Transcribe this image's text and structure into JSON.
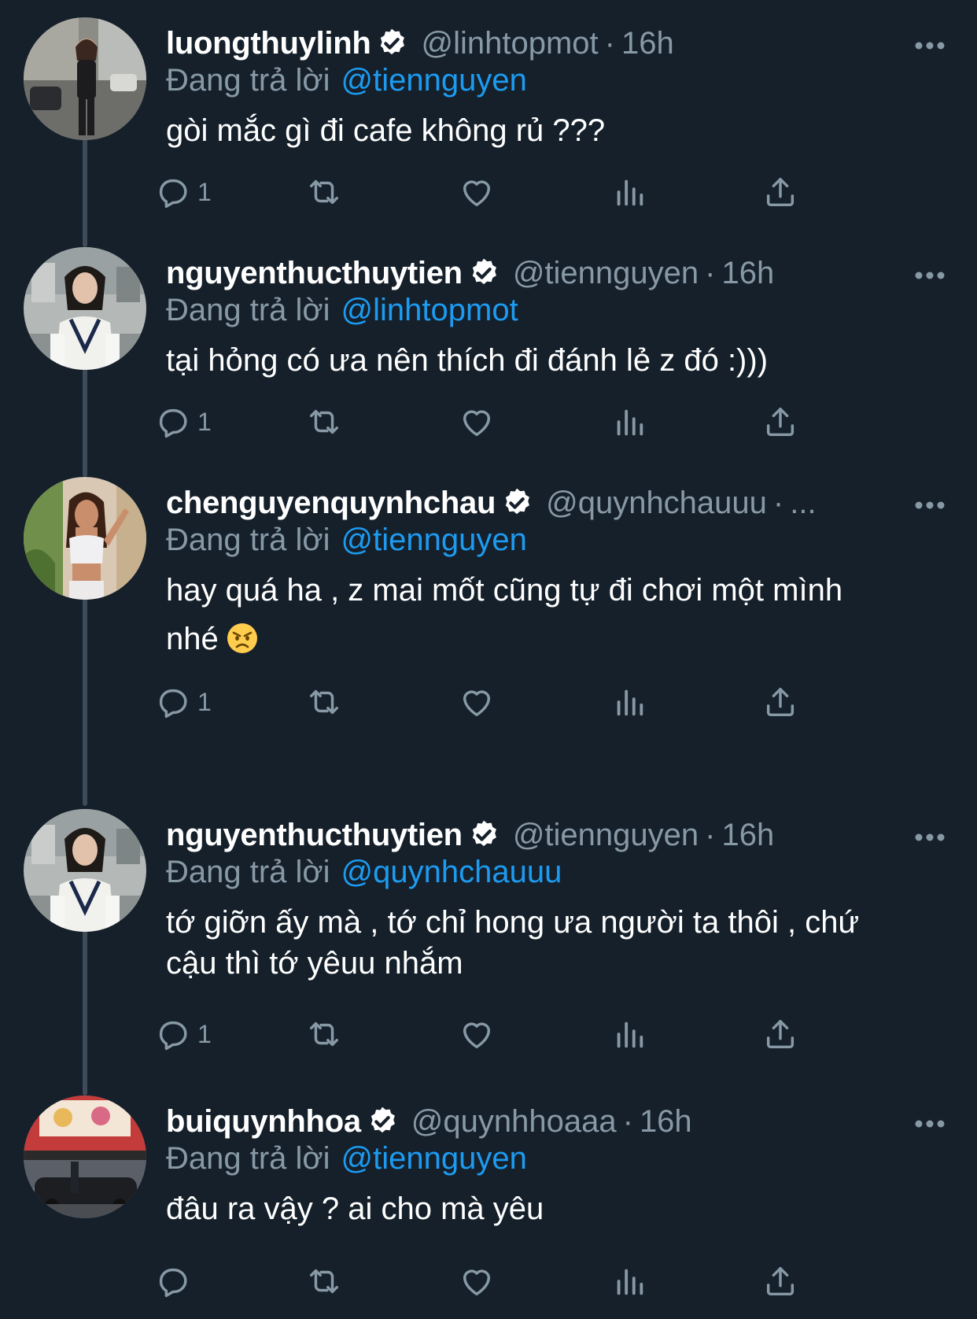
{
  "colors": {
    "background": "#15202b",
    "text": "#ffffff",
    "muted": "#8899a6",
    "mention": "#1d9bf0",
    "icon": "#8899a6",
    "thread_line": "#3d4c5b"
  },
  "reply_prefix": "Đang trả lời",
  "tweets": [
    {
      "display_name": "luongthuylinh",
      "handle": "@linhtopmot",
      "separator": "·",
      "time": "16h",
      "reply_to": "@tiennguyen",
      "text_lines": [
        "gòi mắc gì đi cafe không rủ ???"
      ],
      "emoji": "",
      "reply_count": "1",
      "icons": [
        "reply-icon",
        "retweet-icon",
        "like-icon",
        "analytics-icon",
        "share-icon"
      ]
    },
    {
      "display_name": "nguyenthucthuytien",
      "handle": "@tiennguyen",
      "separator": "·",
      "time": "16h",
      "reply_to": "@linhtopmot",
      "text_lines": [
        "tại hỏng có ưa nên thích đi đánh lẻ z đó :)))"
      ],
      "emoji": "",
      "reply_count": "1",
      "icons": [
        "reply-icon",
        "retweet-icon",
        "like-icon",
        "analytics-icon",
        "share-icon"
      ]
    },
    {
      "display_name": "chenguyenquynhchau",
      "handle": "@quynhchauuu",
      "separator": "·",
      "time": "...",
      "reply_to": "@tiennguyen",
      "text_lines": [
        "hay quá ha , z mai mốt cũng tự đi chơi một mình",
        "nhé"
      ],
      "emoji": "angry-face-emoji",
      "reply_count": "1",
      "icons": [
        "reply-icon",
        "retweet-icon",
        "like-icon",
        "analytics-icon",
        "share-icon"
      ]
    },
    {
      "display_name": "nguyenthucthuytien",
      "handle": "@tiennguyen",
      "separator": "·",
      "time": "16h",
      "reply_to": "@quynhchauuu",
      "text_lines": [
        "tớ giỡn ấy mà , tớ chỉ hong ưa người ta thôi , chứ",
        "cậu thì tớ yêuu nhắm"
      ],
      "emoji": "",
      "reply_count": "1",
      "icons": [
        "reply-icon",
        "retweet-icon",
        "like-icon",
        "analytics-icon",
        "share-icon"
      ]
    },
    {
      "display_name": "buiquynhhoa",
      "handle": "@quynhhoaaa",
      "separator": "·",
      "time": "16h",
      "reply_to": "@tiennguyen",
      "text_lines": [
        "đâu ra vậy ? ai cho mà yêu"
      ],
      "emoji": "",
      "reply_count": "",
      "icons": [
        "reply-icon",
        "retweet-icon",
        "like-icon",
        "analytics-icon",
        "share-icon"
      ]
    }
  ]
}
